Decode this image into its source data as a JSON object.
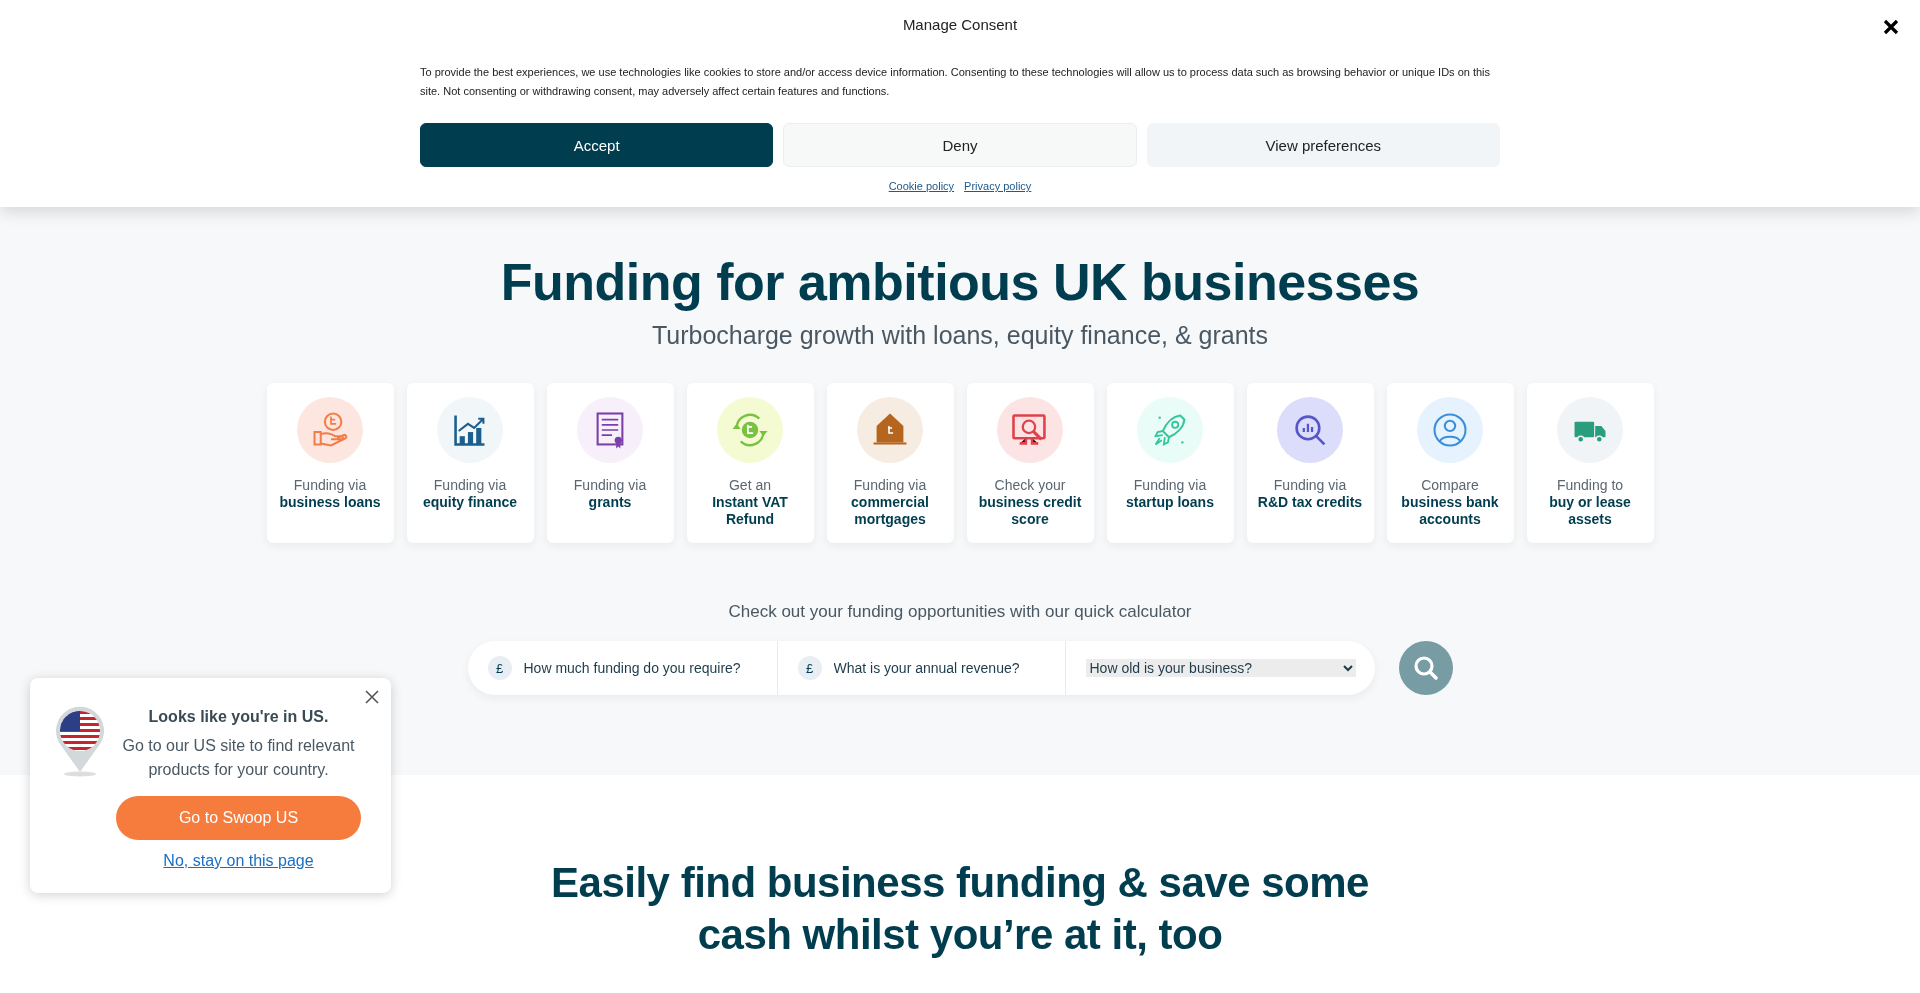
{
  "consent": {
    "title": "Manage Consent",
    "text": "To provide the best experiences, we use technologies like cookies to store and/or access device information. Consenting to these technologies will allow us to process data such as browsing behavior or unique IDs on this site. Not consenting or withdrawing consent, may adversely affect certain features and functions.",
    "buttons": [
      {
        "label": "Accept",
        "kind": "primary"
      },
      {
        "label": "Deny",
        "kind": "secondary"
      },
      {
        "label": "View preferences",
        "kind": "tertiary"
      }
    ],
    "links": [
      "Cookie policy",
      "Privacy policy"
    ]
  },
  "hero": {
    "title": "Funding for ambitious UK businesses",
    "subtitle": "Turbocharge growth with loans, equity finance, & grants",
    "cards": [
      {
        "kind": "coin-hand",
        "label": "Funding via",
        "title": "business loans"
      },
      {
        "kind": "chart",
        "label": "Funding via",
        "title": "equity finance"
      },
      {
        "kind": "certificate",
        "label": "Funding via",
        "title": "grants"
      },
      {
        "kind": "coin-arrows",
        "label": "Get an",
        "title": "Instant VAT Refund"
      },
      {
        "kind": "house",
        "label": "Funding via",
        "title": "commercial mortgages"
      },
      {
        "kind": "monitor",
        "label": "Check your",
        "title": "business credit score"
      },
      {
        "kind": "rocket",
        "label": "Funding via",
        "title": "startup loans"
      },
      {
        "kind": "magnifier",
        "label": "Funding via",
        "title": "R&D tax credits"
      },
      {
        "kind": "user",
        "label": "Compare",
        "title": "business bank accounts"
      },
      {
        "kind": "truck",
        "label": "Funding to",
        "title": "buy or lease assets"
      }
    ]
  },
  "calculator": {
    "caption": "Check out your funding opportunities with our quick calculator",
    "fields": [
      {
        "currency": "£",
        "placeholder": "How much funding do you require?"
      },
      {
        "currency": "£",
        "placeholder": "What is your annual revenue?"
      }
    ],
    "select": {
      "value": "How old is your business?"
    }
  },
  "geo_popup": {
    "title": "Looks like you're in US.",
    "text": "Go to our US site to find relevant products for your country.",
    "button": "Go to Swoop US",
    "link": "No, stay on this page"
  },
  "intro": {
    "title": "Easily find business funding & save some cash whilst you’re at it, too"
  }
}
